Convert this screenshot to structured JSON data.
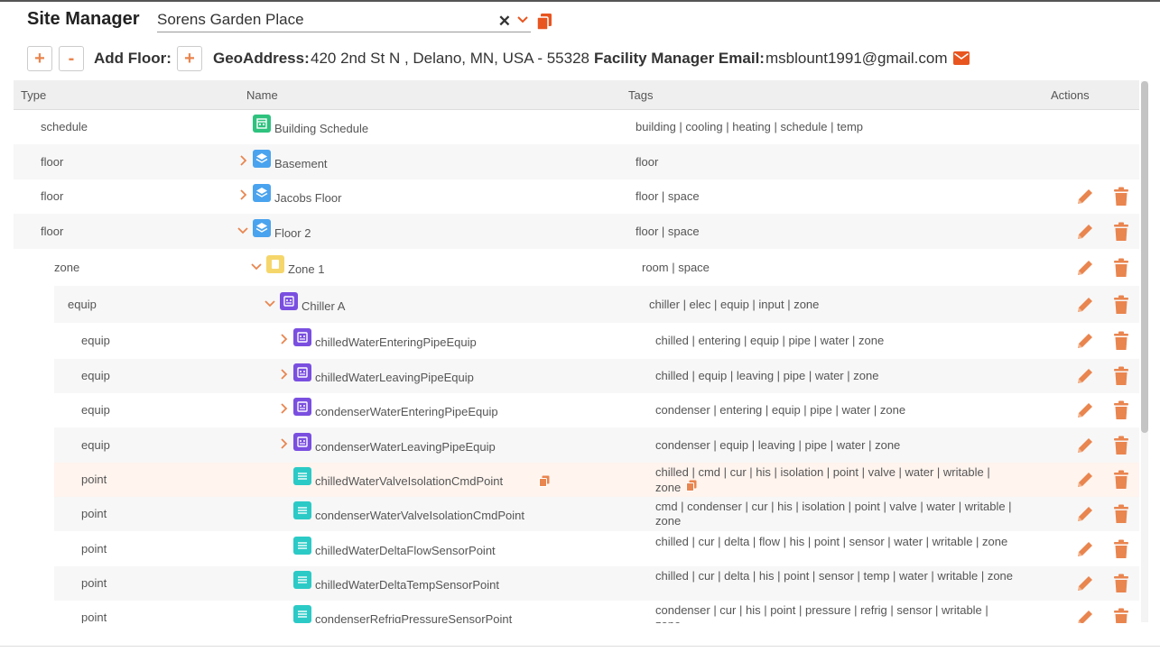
{
  "header": {
    "title": "Site Manager",
    "site_value": "Sorens Garden Place",
    "clear_glyph": "✕"
  },
  "toolbar": {
    "plus_glyph": "+",
    "minus_glyph": "-",
    "add_floor_label": "Add Floor:",
    "geo_label": "GeoAddress:",
    "geo_value": "420 2nd St N , Delano, MN, USA - 55328",
    "email_label": "Facility Manager Email:",
    "email_value": "msblount1991@gmail.com"
  },
  "grid": {
    "columns": {
      "type": "Type",
      "name": "Name",
      "tags": "Tags",
      "actions": "Actions"
    },
    "rows": [
      {
        "type": "schedule",
        "name": "Building Schedule",
        "tags": "building | cooling | heating | schedule | temp",
        "icon": "calendar-icon",
        "depth": 0,
        "expander": "none",
        "actions": false
      },
      {
        "type": "floor",
        "name": "Basement",
        "tags": "floor",
        "icon": "layers-icon",
        "depth": 0,
        "expander": "collapsed",
        "actions": false
      },
      {
        "type": "floor",
        "name": "Jacobs Floor",
        "tags": "floor | space",
        "icon": "layers-icon",
        "depth": 0,
        "expander": "collapsed",
        "actions": true
      },
      {
        "type": "floor",
        "name": "Floor 2",
        "tags": "floor | space",
        "icon": "layers-icon",
        "depth": 0,
        "expander": "expanded",
        "actions": true
      },
      {
        "type": "zone",
        "name": "Zone 1",
        "tags": "room | space",
        "icon": "zone-icon",
        "depth": 1,
        "expander": "expanded",
        "actions": true
      },
      {
        "type": "equip",
        "name": "Chiller A",
        "tags": "chiller | elec | equip | input | zone",
        "icon": "equip-icon",
        "depth": 2,
        "expander": "expanded",
        "actions": true
      },
      {
        "type": "equip",
        "name": "chilledWaterEnteringPipeEquip",
        "tags": "chilled | entering | equip | pipe | water | zone",
        "icon": "equip-icon",
        "depth": 3,
        "expander": "collapsed",
        "actions": true
      },
      {
        "type": "equip",
        "name": "chilledWaterLeavingPipeEquip",
        "tags": "chilled | equip | leaving | pipe | water | zone",
        "icon": "equip-icon",
        "depth": 3,
        "expander": "collapsed",
        "actions": true
      },
      {
        "type": "equip",
        "name": "condenserWaterEnteringPipeEquip",
        "tags": "condenser | entering | equip | pipe | water | zone",
        "icon": "equip-icon",
        "depth": 3,
        "expander": "collapsed",
        "actions": true
      },
      {
        "type": "equip",
        "name": "condenserWaterLeavingPipeEquip",
        "tags": "condenser | equip | leaving | pipe | water | zone",
        "icon": "equip-icon",
        "depth": 3,
        "expander": "collapsed",
        "actions": true
      },
      {
        "type": "point",
        "name": "chilledWaterValveIsolationCmdPoint",
        "tags": "chilled | cmd | cur | his | isolation | point | valve | water | writable | zone",
        "icon": "point-icon",
        "depth": 3,
        "expander": "none",
        "actions": true,
        "highlight": true
      },
      {
        "type": "point",
        "name": "condenserWaterValveIsolationCmdPoint",
        "tags": "cmd | condenser | cur | his | isolation | point | valve | water | writable | zone",
        "icon": "point-icon",
        "depth": 3,
        "expander": "none",
        "actions": true
      },
      {
        "type": "point",
        "name": "chilledWaterDeltaFlowSensorPoint",
        "tags": "chilled | cur | delta | flow | his | point | sensor | water | writable | zone",
        "icon": "point-icon",
        "depth": 3,
        "expander": "none",
        "actions": true
      },
      {
        "type": "point",
        "name": "chilledWaterDeltaTempSensorPoint",
        "tags": "chilled | cur | delta | his | point | sensor | temp | water | writable | zone",
        "icon": "point-icon",
        "depth": 3,
        "expander": "none",
        "actions": true
      },
      {
        "type": "point",
        "name": "condenserRefrigPressureSensorPoint",
        "tags": "condenser | cur | his | point | pressure | refrig | sensor | writable | zone",
        "icon": "point-icon",
        "depth": 3,
        "expander": "none",
        "actions": true
      }
    ]
  },
  "colors": {
    "accent": "#e9854f",
    "calendar": "#2ec27e",
    "layers": "#4aa3ee",
    "zone": "#f5d66b",
    "equip": "#7a4fe0",
    "point": "#2ccac6",
    "highlight_row": "#fff4ee",
    "alt_row": "#f7f7f7",
    "mail": "#e8551f"
  }
}
